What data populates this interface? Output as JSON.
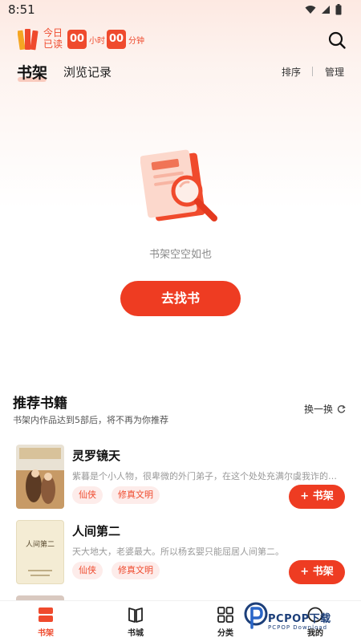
{
  "status_bar": {
    "time": "8:51",
    "icons": [
      "wifi-icon",
      "signal-icon",
      "battery-icon"
    ]
  },
  "reading_stats": {
    "today_label": "今日已读",
    "hours": "00",
    "hours_unit": "小时",
    "minutes": "00",
    "minutes_unit": "分钟"
  },
  "tabs": {
    "bookshelf": "书架",
    "history": "浏览记录",
    "sort": "排序",
    "manage": "管理"
  },
  "empty_state": {
    "message": "书架空空如也",
    "button": "去找书"
  },
  "recommend": {
    "title": "推荐书籍",
    "subtitle": "书架内作品达到5部后，将不再为你推荐",
    "refresh_label": "换一换",
    "books": [
      {
        "title": "灵罗镜天",
        "desc": "紫暮是个小人物，很卑微的外门弟子，在这个处处充满尔虞我诈的世界",
        "tags": [
          "仙侠",
          "修真文明"
        ],
        "add_label": "书架"
      },
      {
        "title": "人间第二",
        "desc": "天大地大，老婆最大。所以杨玄婴只能屈居人间第二。",
        "tags": [
          "仙侠",
          "修真文明"
        ],
        "add_label": "书架",
        "cover_title": "人间第二"
      }
    ]
  },
  "bottom_nav": [
    {
      "label": "书架",
      "icon": "bookshelf-icon",
      "active": true
    },
    {
      "label": "书城",
      "icon": "book-city-icon",
      "active": false
    },
    {
      "label": "分类",
      "icon": "category-icon",
      "active": false
    },
    {
      "label": "我的",
      "icon": "profile-icon",
      "active": false
    }
  ],
  "watermark": {
    "brand": "PCPOP下载",
    "sub": "PCPOP Download"
  },
  "colors": {
    "accent": "#ee3c22",
    "tag_bg": "#fdecea"
  }
}
